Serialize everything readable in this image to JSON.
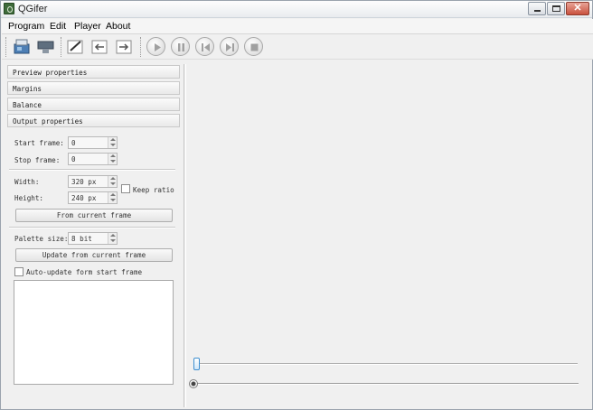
{
  "window": {
    "title": "QGifer"
  },
  "menu": {
    "items": [
      "Program",
      "Edit",
      "Player",
      "About"
    ]
  },
  "toolbar": {
    "icons": [
      "open-video-icon",
      "extract-gif-icon",
      "edit-icon",
      "previous-frame-icon",
      "next-frame-icon"
    ],
    "player": [
      "play-icon",
      "pause-icon",
      "skip-start-icon",
      "skip-end-icon",
      "stop-icon"
    ]
  },
  "sections": [
    "Preview properties",
    "Margins",
    "Balance",
    "Output properties"
  ],
  "output": {
    "start_frame_label": "Start frame:",
    "start_frame_value": "0",
    "stop_frame_label": "Stop frame:",
    "stop_frame_value": "0",
    "width_label": "Width:",
    "width_value": "320 px",
    "height_label": "Height:",
    "height_value": "240 px",
    "keep_ratio_label": "Keep ratio",
    "keep_ratio_checked": false,
    "from_current_frame_label": "From current frame",
    "palette_size_label": "Palette size:",
    "palette_size_value": "8 bit",
    "update_button_label": "Update from current frame",
    "auto_update_label": "Auto-update form start frame",
    "auto_update_checked": false
  },
  "player": {
    "position_fraction": 0.0,
    "range_start_fraction": 0.0
  },
  "colors": {
    "slider_accent": "#3f8fd0",
    "close_button": "#c9513e"
  }
}
